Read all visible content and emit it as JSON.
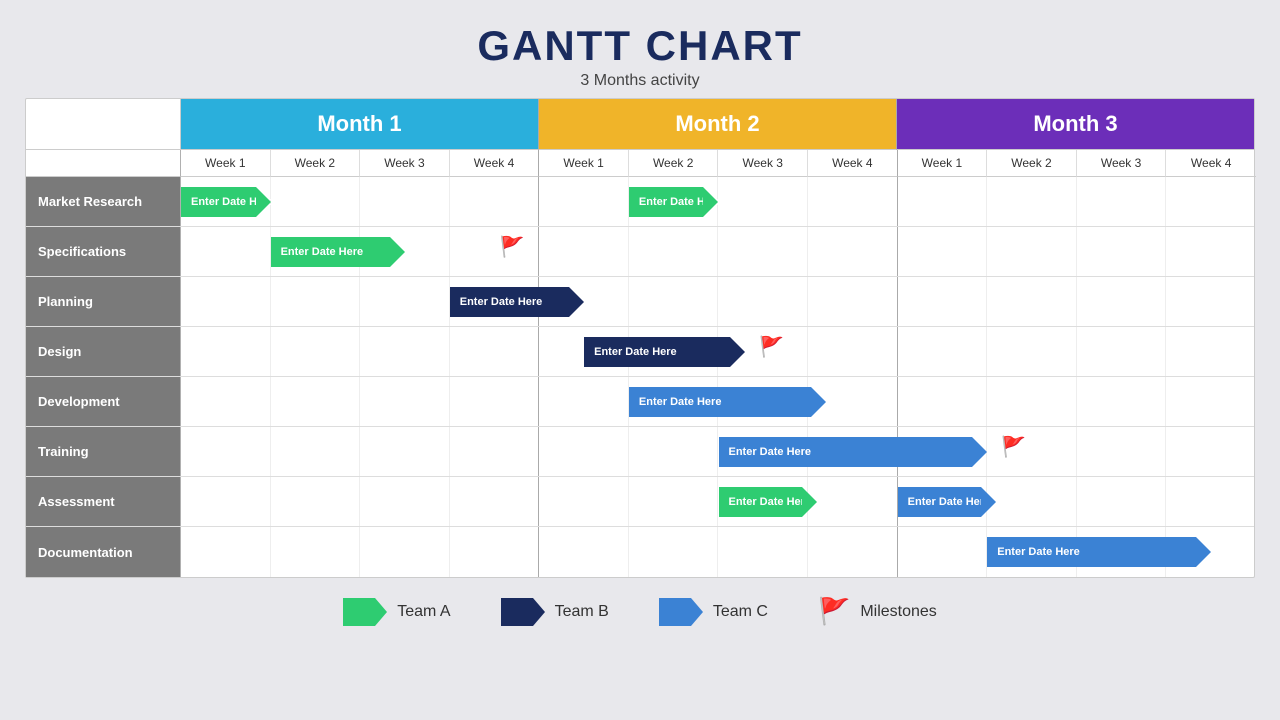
{
  "title": "GANTT CHART",
  "subtitle": "3 Months activity",
  "months": [
    {
      "label": "Month 1",
      "colorClass": "month1-bg"
    },
    {
      "label": "Month 2",
      "colorClass": "month2-bg"
    },
    {
      "label": "Month 3",
      "colorClass": "month3-bg"
    }
  ],
  "weeks": [
    "Week 1",
    "Week 2",
    "Week 3",
    "Week 4",
    "Week 1",
    "Week 2",
    "Week 3",
    "Week 4",
    "Week 1",
    "Week 2",
    "Week 3",
    "Week 4"
  ],
  "rows": [
    {
      "label": "Market Research",
      "bars": [
        {
          "startWeek": 0,
          "spanWeeks": 1.0,
          "type": "green",
          "text": "Enter Date Here"
        },
        {
          "startWeek": 5,
          "spanWeeks": 1.0,
          "type": "green",
          "text": "Enter Date Here"
        }
      ],
      "flags": []
    },
    {
      "label": "Specifications",
      "bars": [
        {
          "startWeek": 1,
          "spanWeeks": 1.5,
          "type": "green",
          "text": "Enter Date Here"
        }
      ],
      "flags": [
        {
          "weekPos": 3.6,
          "color": "flag-purple"
        }
      ]
    },
    {
      "label": "Planning",
      "bars": [
        {
          "startWeek": 3,
          "spanWeeks": 1.5,
          "type": "dark-blue",
          "text": "Enter Date Here"
        }
      ],
      "flags": []
    },
    {
      "label": "Design",
      "bars": [
        {
          "startWeek": 4.5,
          "spanWeeks": 1.8,
          "type": "dark-blue",
          "text": "Enter Date Here"
        }
      ],
      "flags": [
        {
          "weekPos": 6.5,
          "color": "flag-purple"
        }
      ]
    },
    {
      "label": "Development",
      "bars": [
        {
          "startWeek": 5,
          "spanWeeks": 2.2,
          "type": "mid-blue",
          "text": "Enter Date Here"
        }
      ],
      "flags": []
    },
    {
      "label": "Training",
      "bars": [
        {
          "startWeek": 6,
          "spanWeeks": 3.0,
          "type": "mid-blue",
          "text": "Enter Date Here"
        }
      ],
      "flags": [
        {
          "weekPos": 9.2,
          "color": "flag-purple"
        }
      ]
    },
    {
      "label": "Assessment",
      "bars": [
        {
          "startWeek": 6,
          "spanWeeks": 1.1,
          "type": "green",
          "text": "Enter Date Here"
        },
        {
          "startWeek": 8,
          "spanWeeks": 1.1,
          "type": "mid-blue",
          "text": "Enter Date Here"
        }
      ],
      "flags": []
    },
    {
      "label": "Documentation",
      "bars": [
        {
          "startWeek": 9,
          "spanWeeks": 2.5,
          "type": "mid-blue",
          "text": "Enter Date Here"
        }
      ],
      "flags": []
    }
  ],
  "legend": [
    {
      "label": "Team A",
      "type": "green"
    },
    {
      "label": "Team B",
      "type": "dark-blue"
    },
    {
      "label": "Team C",
      "type": "mid-blue"
    },
    {
      "label": "Milestones",
      "type": "flag"
    }
  ]
}
